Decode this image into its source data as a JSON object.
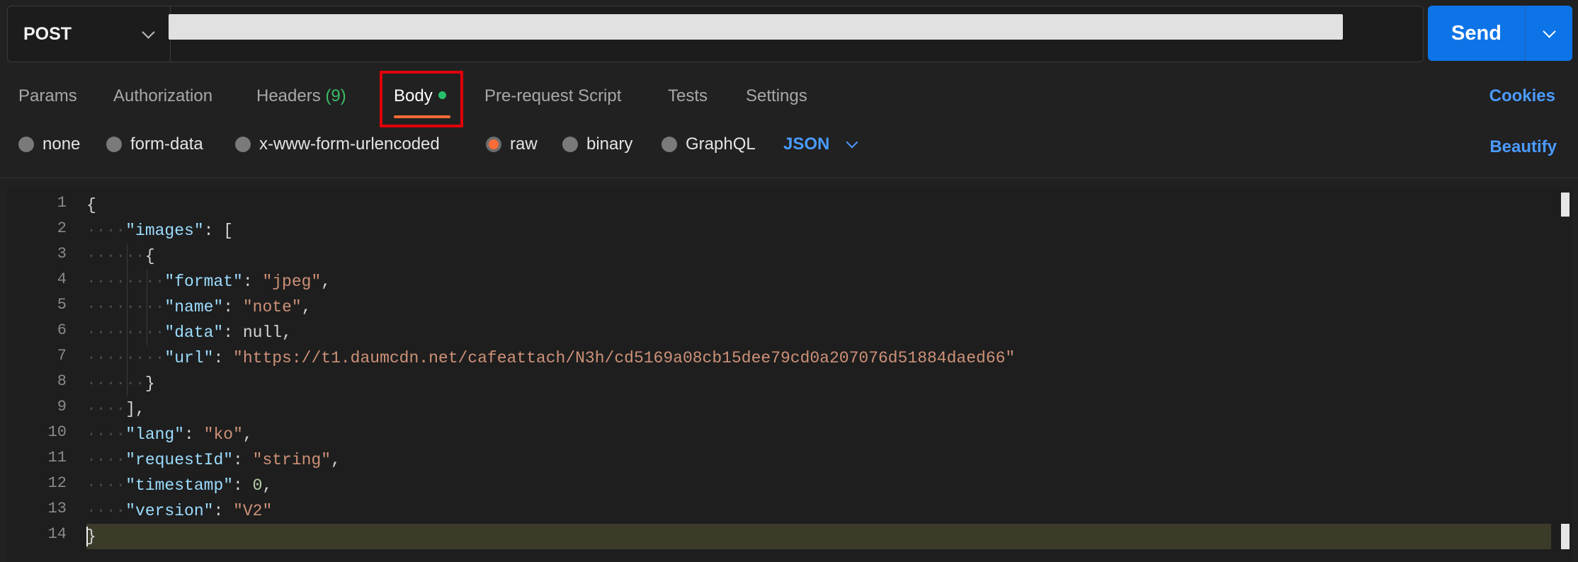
{
  "request": {
    "method": "POST",
    "url_value": "",
    "send_label": "Send"
  },
  "tabs": {
    "items": [
      {
        "label": "Params"
      },
      {
        "label": "Authorization"
      },
      {
        "label": "Headers",
        "count": "(9)"
      },
      {
        "label": "Body",
        "active": true
      },
      {
        "label": "Pre-request Script"
      },
      {
        "label": "Tests"
      },
      {
        "label": "Settings"
      }
    ],
    "cookies_label": "Cookies"
  },
  "body_type": {
    "options": [
      "none",
      "form-data",
      "x-www-form-urlencoded",
      "raw",
      "binary",
      "GraphQL"
    ],
    "selected": "raw",
    "format": "JSON",
    "beautify_label": "Beautify"
  },
  "editor": {
    "line_numbers": [
      "1",
      "2",
      "3",
      "4",
      "5",
      "6",
      "7",
      "8",
      "9",
      "10",
      "11",
      "12",
      "13",
      "14"
    ],
    "lines": [
      "{",
      "\"images\": [",
      "{",
      "\"format\": \"jpeg\",",
      "\"name\": \"note\",",
      "\"data\": null,",
      "\"url\": \"https://t1.daumcdn.net/cafeattach/N3h/cd5169a08cb15dee79cd0a207076d51884daed66\"",
      "}",
      "],",
      "\"lang\": \"ko\",",
      "\"requestId\": \"string\",",
      "\"timestamp\": 0,",
      "\"version\": \"V2\"",
      "}"
    ]
  },
  "colors": {
    "accent": "#ff6c37",
    "send_button": "#0d74e7",
    "link_blue": "#4a9bff",
    "highlight_box": "#e0000a",
    "status_green": "#27c06a"
  },
  "icons": [
    "chevron-down-icon",
    "radio-icon",
    "status-dot-icon"
  ]
}
